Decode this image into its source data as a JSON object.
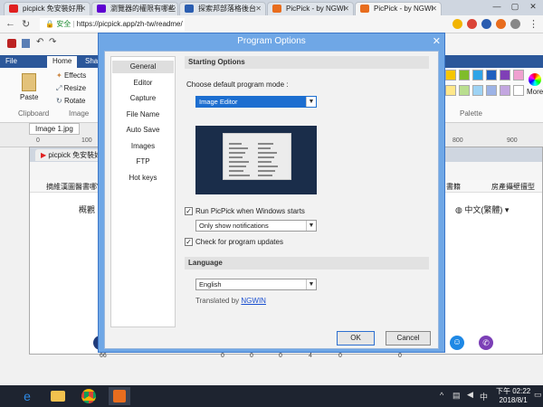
{
  "browser": {
    "tabs": [
      {
        "title": "picpick 免安裝好用",
        "icon": "youtube-icon",
        "color": "#e02020",
        "active": false
      },
      {
        "title": "瀏覽器的權限有哪些",
        "icon": "yahoo-icon",
        "color": "#5f01d1",
        "active": false
      },
      {
        "title": "探索邦部落格後台",
        "icon": "blogger-icon",
        "color": "#2a5db0",
        "active": false
      },
      {
        "title": "PicPick - by NGWI",
        "icon": "picpick-icon",
        "color": "#e86d1e",
        "active": false
      },
      {
        "title": "PicPick - by NGWI",
        "icon": "picpick-icon",
        "color": "#e86d1e",
        "active": true
      }
    ],
    "security_label": "安全",
    "url": "https://picpick.app/zh-tw/readme/"
  },
  "ribbon": {
    "tabs": [
      "File",
      "Home",
      "Sha"
    ],
    "selected_tab": "Home",
    "effects": "Effects",
    "resize": "Resize",
    "rotate": "Rotate",
    "paste": "Paste",
    "clipboard_group": "Clipboard",
    "image_group": "Image",
    "palette_group": "Palette",
    "more": "More",
    "palette_colors": [
      "#f6c600",
      "#7fbc2a",
      "#2fa4e7",
      "#1f5fbf",
      "#7f3fb6",
      "#f0a0d0",
      "#ffe78a",
      "#b9de8f",
      "#9ed3f4",
      "#9db3e6",
      "#c3a6e0",
      "#ffffff"
    ]
  },
  "document": {
    "tab_label": "Image 1.jpg",
    "ruler_marks": [
      "0",
      "100",
      "800",
      "900"
    ]
  },
  "inner_page": {
    "tab_title": "picpick 免安裝好用",
    "bookmark_left": "摘維漢圖醫書哪's",
    "nav_left": "概觀",
    "bookmark_right1": "書籍",
    "bookmark_right2": "房產攝壁擅型",
    "language_label": "中文(繁體)",
    "number_row": [
      "66",
      "0",
      "0",
      "0",
      "4",
      "0",
      "0"
    ]
  },
  "dialog": {
    "title": "Program Options",
    "sidebar_items": [
      "General",
      "Editor",
      "Capture",
      "File Name",
      "Auto Save",
      "Images",
      "FTP",
      "Hot keys"
    ],
    "selected_item": "General",
    "starting_section": "Starting Options",
    "mode_label": "Choose default program mode :",
    "mode_value": "Image Editor",
    "run_windows_label": "Run PicPick when Windows starts",
    "run_windows_checked": true,
    "notify_value": "Only show notifications",
    "check_updates_label": "Check for program updates",
    "check_updates_checked": true,
    "language_section": "Language",
    "language_value": "English",
    "translated_by": "Translated by",
    "translator": "NGWIN",
    "ok_label": "OK",
    "cancel_label": "Cancel"
  },
  "taskbar": {
    "time": "下午 02:22",
    "date": "2018/8/1",
    "ime": "中"
  }
}
